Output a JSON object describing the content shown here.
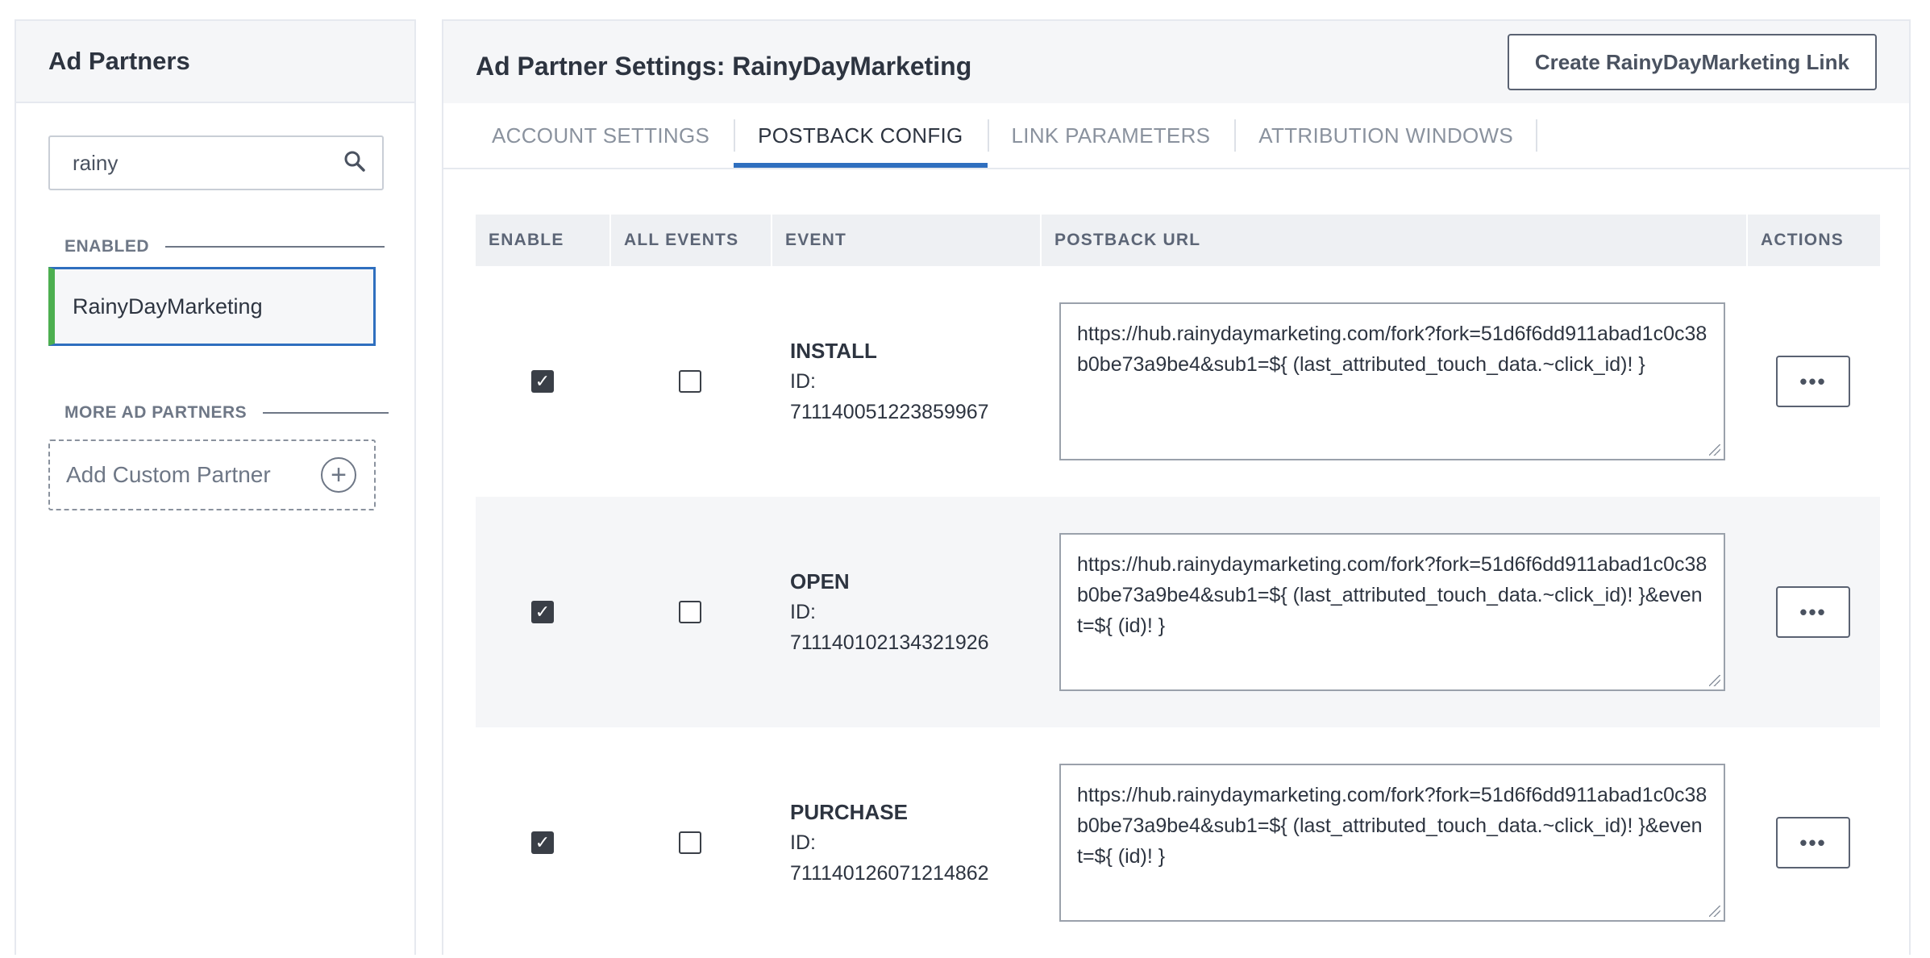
{
  "sidebar": {
    "title": "Ad Partners",
    "search": {
      "value": "rainy",
      "placeholder": ""
    },
    "enabled_label": "ENABLED",
    "enabled_items": [
      {
        "label": "RainyDayMarketing"
      }
    ],
    "more_label": "MORE AD PARTNERS",
    "add_custom_label": "Add Custom Partner"
  },
  "main": {
    "title": "Ad Partner Settings: RainyDayMarketing",
    "create_link_label": "Create RainyDayMarketing Link",
    "tabs": [
      {
        "label": "ACCOUNT SETTINGS",
        "active": false
      },
      {
        "label": "POSTBACK CONFIG",
        "active": true
      },
      {
        "label": "LINK PARAMETERS",
        "active": false
      },
      {
        "label": "ATTRIBUTION WINDOWS",
        "active": false
      }
    ]
  },
  "table": {
    "headers": [
      "ENABLE",
      "ALL EVENTS",
      "EVENT",
      "POSTBACK URL",
      "ACTIONS"
    ],
    "rows": [
      {
        "enable": true,
        "all_events": false,
        "event": "INSTALL",
        "id_label": "ID:",
        "id": "711140051223859967",
        "url": "https://hub.rainydaymarketing.com/fork?fork=51d6f6dd911abad1c0c38b0be73a9be4&sub1=${ (last_attributed_touch_data.~click_id)! }",
        "actions": "•••"
      },
      {
        "enable": true,
        "all_events": false,
        "event": "OPEN",
        "id_label": "ID:",
        "id": "711140102134321926",
        "url": "https://hub.rainydaymarketing.com/fork?fork=51d6f6dd911abad1c0c38b0be73a9be4&sub1=${ (last_attributed_touch_data.~click_id)! }&event=${ (id)! }",
        "actions": "•••"
      },
      {
        "enable": true,
        "all_events": false,
        "event": "PURCHASE",
        "id_label": "ID:",
        "id": "711140126071214862",
        "url": "https://hub.rainydaymarketing.com/fork?fork=51d6f6dd911abad1c0c38b0be73a9be4&sub1=${ (last_attributed_touch_data.~click_id)! }&event=${ (id)! }",
        "actions": "•••"
      }
    ]
  },
  "colors": {
    "accent_blue": "#2f6fbf",
    "enabled_green": "#4caf50",
    "panel_bg": "#f5f6f8"
  },
  "icons": {
    "search": "search-icon",
    "plus": "plus-circle-icon",
    "more": "more-horizontal-icon"
  }
}
